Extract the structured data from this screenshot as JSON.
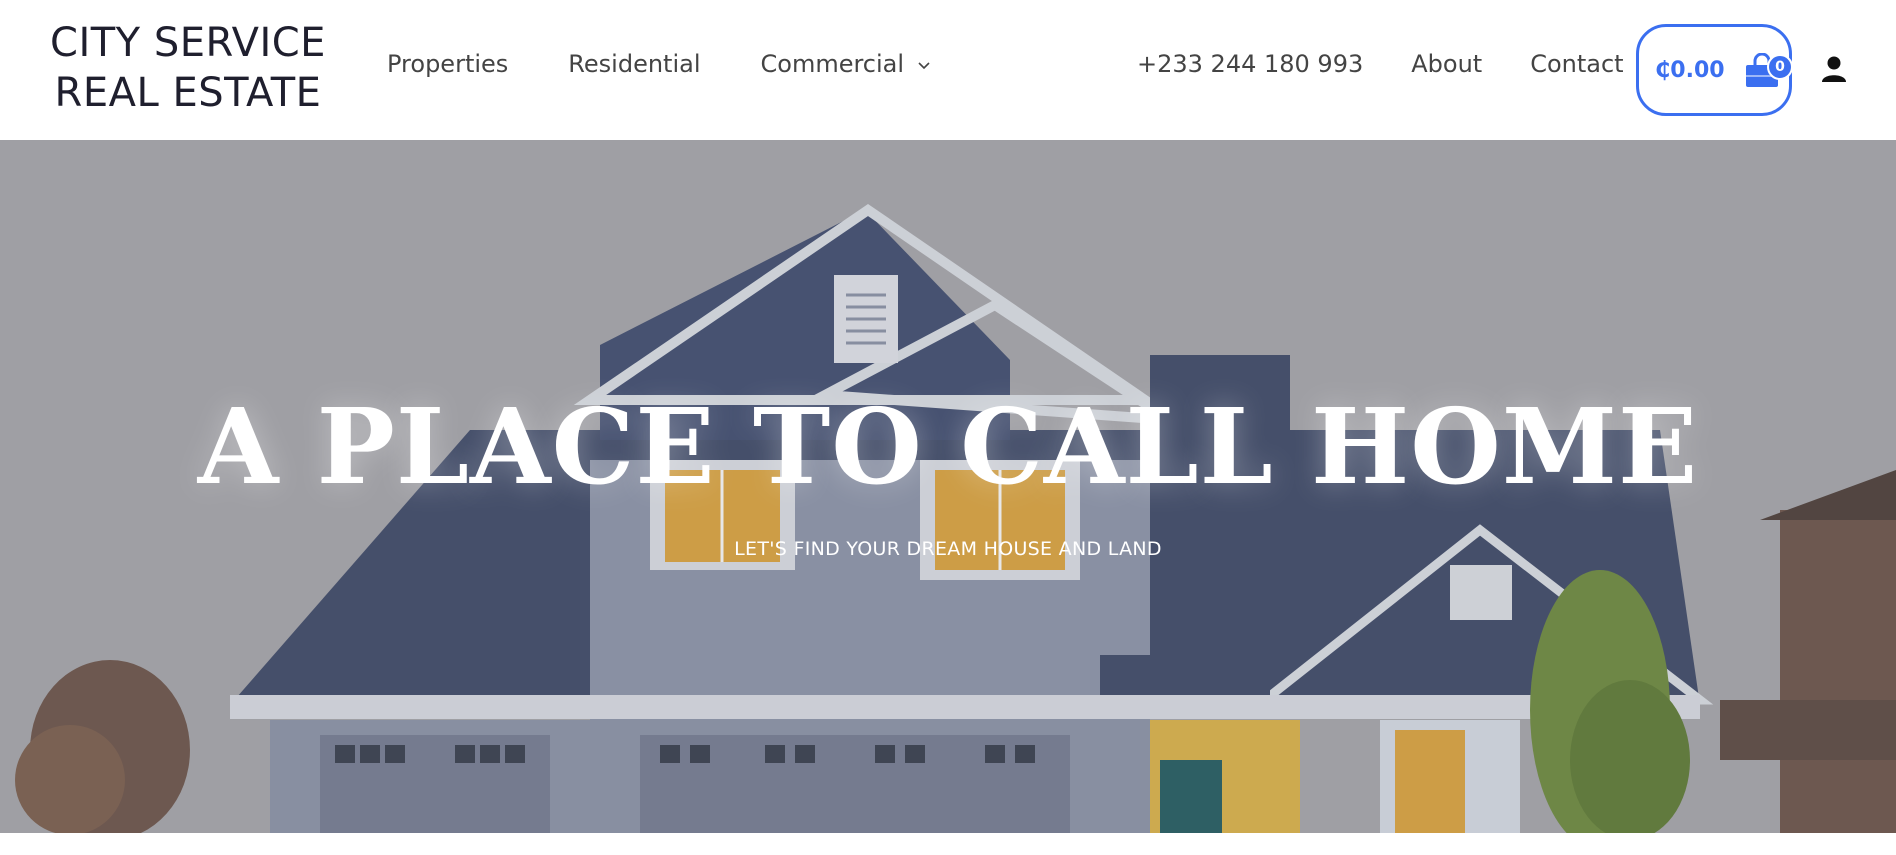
{
  "logo": {
    "line1": "CITY SERVICE",
    "line2": "REAL ESTATE"
  },
  "nav": {
    "properties": "Properties",
    "residential": "Residential",
    "commercial": "Commercial",
    "phone": "+233 244 180 993",
    "about": "About",
    "contact": "Contact"
  },
  "cart": {
    "total": "₵0.00",
    "count": "0",
    "accent": "#3b6ff0"
  },
  "icons": {
    "cart": "shopping-bag-icon",
    "user": "user-icon",
    "dropdown": "chevron-down-icon"
  },
  "hero": {
    "title": "A PLACE TO CALL HOME",
    "subtitle": "LET'S FIND YOUR DREAM HOUSE AND LAND"
  }
}
